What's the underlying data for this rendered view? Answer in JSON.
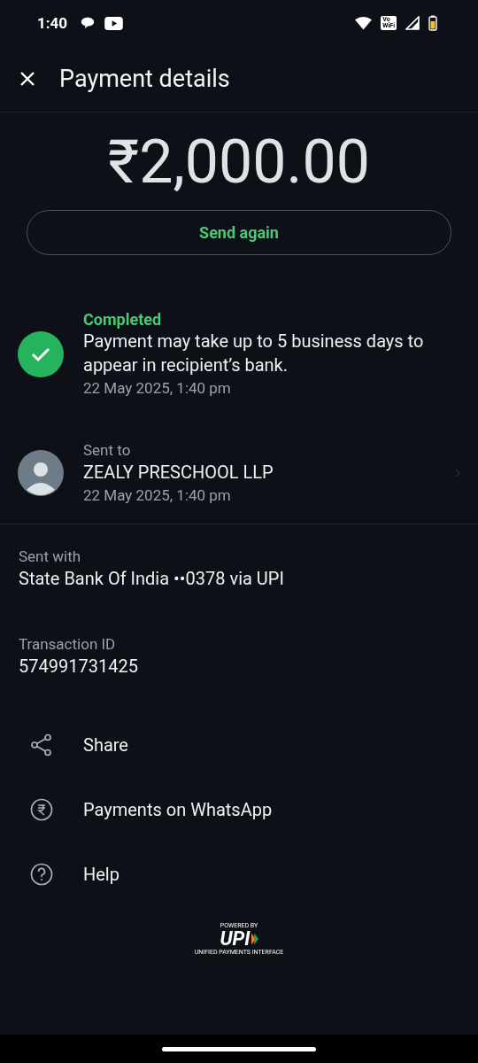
{
  "status_bar": {
    "time": "1:40",
    "wifi_badge": [
      "Vo",
      "WiFi"
    ]
  },
  "header": {
    "title": "Payment details"
  },
  "amount": "₹2,000.00",
  "send_again_button": "Send again",
  "status": {
    "label": "Completed",
    "message": "Payment may take up to 5 business days to appear in recipient’s bank.",
    "time": "22 May 2025, 1:40 pm"
  },
  "recipient": {
    "caption": "Sent to",
    "name": "ZEALY PRESCHOOL LLP",
    "time": "22 May 2025, 1:40 pm"
  },
  "details": [
    {
      "label": "Sent with",
      "value": "State Bank Of India ••0378 via UPI"
    },
    {
      "label": "Transaction ID",
      "value": "574991731425"
    }
  ],
  "actions": [
    {
      "kind": "share",
      "label": "Share"
    },
    {
      "kind": "rupee",
      "label": "Payments on WhatsApp"
    },
    {
      "kind": "help",
      "label": "Help"
    }
  ],
  "footer_logo": {
    "top": "POWERED BY",
    "mark": "UPI",
    "bottom": "UNIFIED PAYMENTS INTERFACE"
  }
}
